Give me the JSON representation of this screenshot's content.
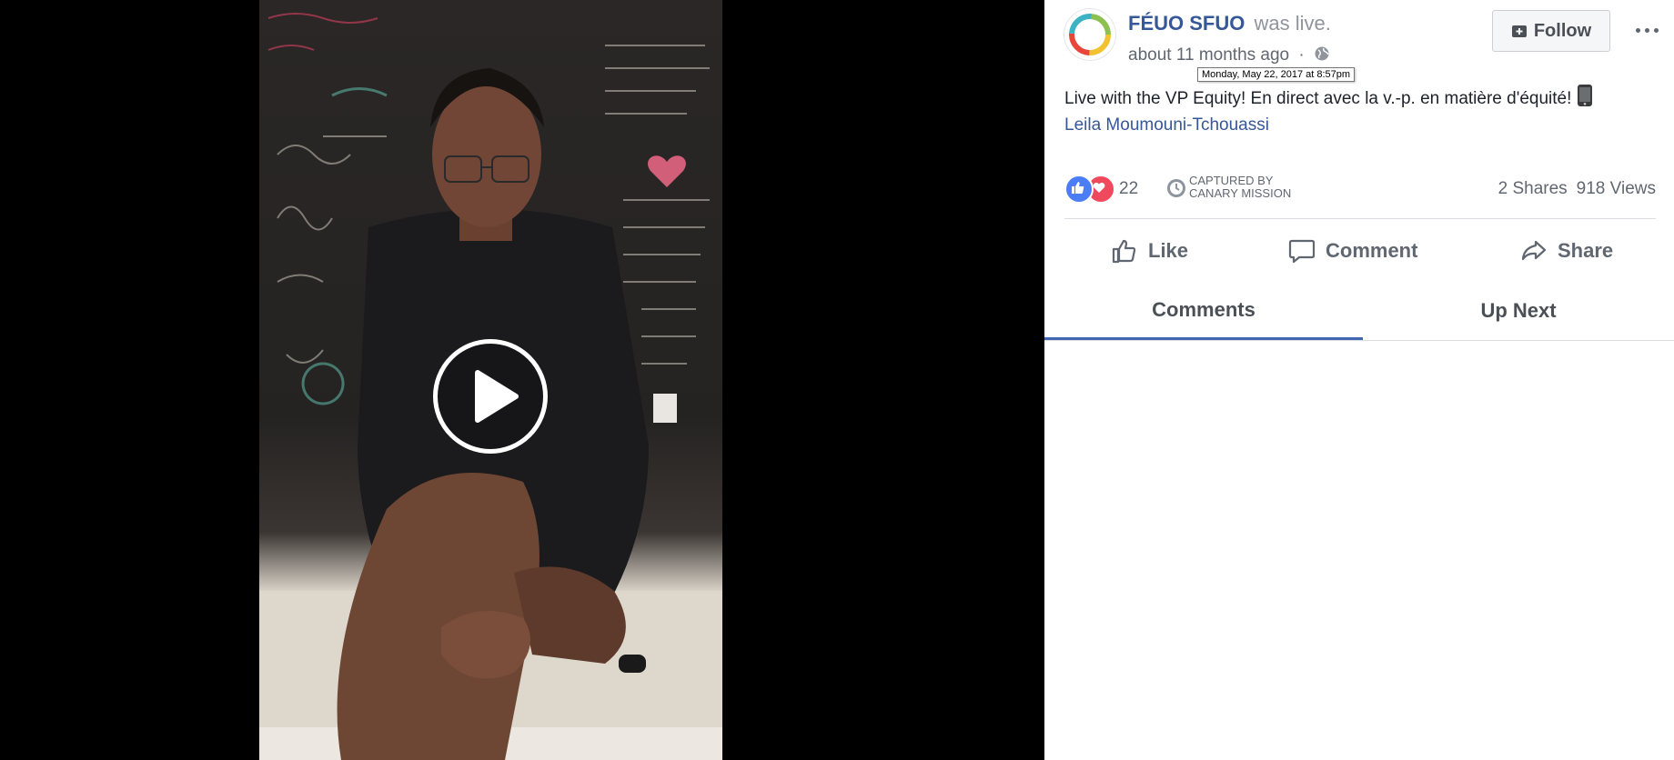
{
  "post": {
    "page_name": "FÉUO SFUO",
    "status": "was live.",
    "time_ago": "about 11 months ago",
    "separator": "·",
    "timestamp_tooltip": "Monday, May 22, 2017 at 8:57pm",
    "description": "Live with the VP Equity! En direct avec la v.-p. en matière d'équité!",
    "tagged_person": "Leila Moumouni-Tchouassi"
  },
  "header": {
    "follow_label": "Follow"
  },
  "stats": {
    "reaction_count": "22",
    "captured_line1": "CAPTURED BY",
    "captured_line2": "CANARY MISSION",
    "shares": "2 Shares",
    "views": "918 Views"
  },
  "actions": {
    "like": "Like",
    "comment": "Comment",
    "share": "Share"
  },
  "tabs": {
    "comments": "Comments",
    "up_next": "Up Next"
  },
  "colors": {
    "link": "#365899",
    "like_reaction": "#4a7df6",
    "love_reaction": "#f0485c",
    "active_tab_underline": "#4267b2"
  },
  "icons": [
    "play-icon",
    "globe-icon",
    "follow-icon",
    "more-icon",
    "phone-icon",
    "like-reaction-icon",
    "love-reaction-icon",
    "captured-clock-icon",
    "like-icon",
    "comment-icon",
    "share-icon"
  ]
}
